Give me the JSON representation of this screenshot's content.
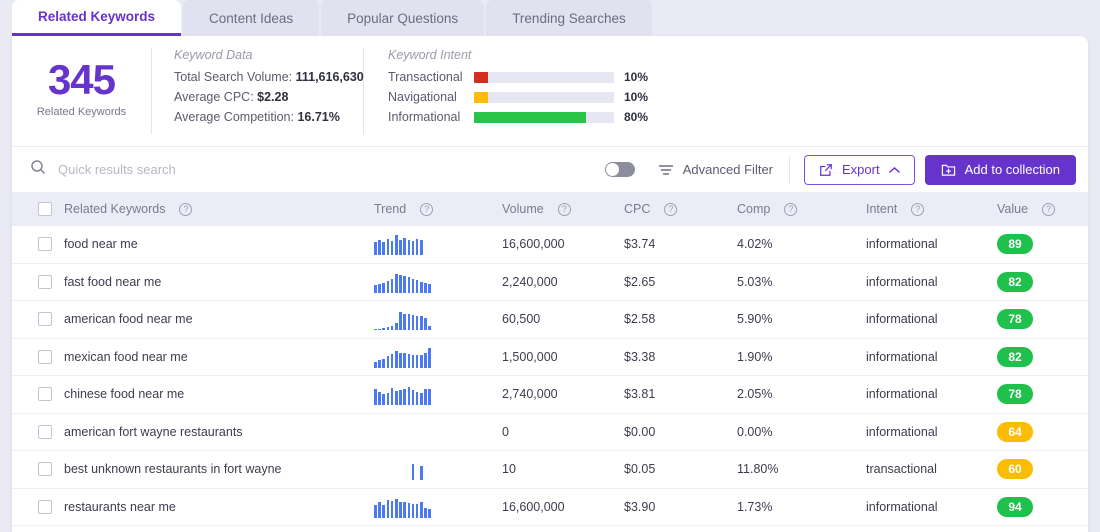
{
  "tabs": [
    {
      "label": "Related Keywords",
      "active": true
    },
    {
      "label": "Content Ideas",
      "active": false
    },
    {
      "label": "Popular Questions",
      "active": false
    },
    {
      "label": "Trending Searches",
      "active": false
    }
  ],
  "summary": {
    "count": "345",
    "count_label": "Related Keywords",
    "keyword_data": {
      "title": "Keyword Data",
      "rows": [
        {
          "label": "Total Search Volume:",
          "value": "111,616,630"
        },
        {
          "label": "Average CPC:",
          "value": "$2.28"
        },
        {
          "label": "Average Competition:",
          "value": "16.71%"
        }
      ]
    },
    "keyword_intent": {
      "title": "Keyword Intent",
      "rows": [
        {
          "label": "Transactional",
          "pct": "10%",
          "width": 10,
          "color": "#d32f20"
        },
        {
          "label": "Navigational",
          "pct": "10%",
          "width": 10,
          "color": "#fbbc05"
        },
        {
          "label": "Informational",
          "pct": "80%",
          "width": 80,
          "color": "#28c348"
        }
      ]
    }
  },
  "toolbar": {
    "search_placeholder": "Quick results search",
    "search_value": "",
    "advanced_filter_label": "Advanced Filter",
    "advanced_filter_on": false,
    "export_label": "Export",
    "add_to_collection_label": "Add to collection",
    "accent_color": "#6633cc"
  },
  "table": {
    "columns": [
      {
        "key": "keyword",
        "label": "Related Keywords",
        "help": true
      },
      {
        "key": "trend",
        "label": "Trend",
        "help": true
      },
      {
        "key": "volume",
        "label": "Volume",
        "help": true
      },
      {
        "key": "cpc",
        "label": "CPC",
        "help": true
      },
      {
        "key": "comp",
        "label": "Comp",
        "help": true
      },
      {
        "key": "intent",
        "label": "Intent",
        "help": true
      },
      {
        "key": "value",
        "label": "Value",
        "help": true
      }
    ],
    "rows": [
      {
        "keyword": "food near me",
        "trend": [
          62,
          70,
          60,
          72,
          64,
          92,
          70,
          78,
          70,
          66,
          72,
          68
        ],
        "volume": "16,600,000",
        "cpc": "$3.74",
        "comp": "4.02%",
        "intent": "informational",
        "value": "89",
        "value_color": "#1fc04b"
      },
      {
        "keyword": "fast food near me",
        "trend": [
          34,
          40,
          46,
          52,
          64,
          86,
          80,
          74,
          72,
          64,
          60,
          48,
          44,
          40
        ],
        "volume": "2,240,000",
        "cpc": "$2.65",
        "comp": "5.03%",
        "intent": "informational",
        "value": "82",
        "value_color": "#1fc04b"
      },
      {
        "keyword": "american food near me",
        "trend": [
          8,
          8,
          10,
          14,
          20,
          34,
          82,
          72,
          74,
          70,
          66,
          64,
          58,
          18
        ],
        "volume": "60,500",
        "cpc": "$2.58",
        "comp": "5.90%",
        "intent": "informational",
        "value": "78",
        "value_color": "#1fc04b"
      },
      {
        "keyword": "mexican food near me",
        "trend": [
          26,
          34,
          40,
          52,
          62,
          74,
          68,
          66,
          62,
          60,
          58,
          56,
          66,
          88
        ],
        "volume": "1,500,000",
        "cpc": "$3.38",
        "comp": "1.90%",
        "intent": "informational",
        "value": "82",
        "value_color": "#1fc04b"
      },
      {
        "keyword": "chinese food near me",
        "trend": [
          72,
          62,
          50,
          58,
          78,
          64,
          70,
          76,
          84,
          70,
          62,
          54,
          76,
          72
        ],
        "volume": "2,740,000",
        "cpc": "$3.81",
        "comp": "2.05%",
        "intent": "informational",
        "value": "78",
        "value_color": "#1fc04b"
      },
      {
        "keyword": "american fort wayne restaurants",
        "trend": [],
        "volume": "0",
        "cpc": "$0.00",
        "comp": "0.00%",
        "intent": "informational",
        "value": "64",
        "value_color": "#fbbc05"
      },
      {
        "keyword": "best unknown restaurants in fort wayne",
        "trend": [
          0,
          0,
          0,
          0,
          0,
          0,
          0,
          0,
          0,
          74,
          0,
          66,
          0,
          0
        ],
        "volume": "10",
        "cpc": "$0.05",
        "comp": "11.80%",
        "intent": "transactional",
        "value": "60",
        "value_color": "#fbbc05"
      },
      {
        "keyword": "restaurants near me",
        "trend": [
          58,
          72,
          60,
          80,
          78,
          86,
          72,
          70,
          66,
          64,
          62,
          72,
          46,
          40
        ],
        "volume": "16,600,000",
        "cpc": "$3.90",
        "comp": "1.73%",
        "intent": "informational",
        "value": "94",
        "value_color": "#1fc04b"
      }
    ]
  }
}
